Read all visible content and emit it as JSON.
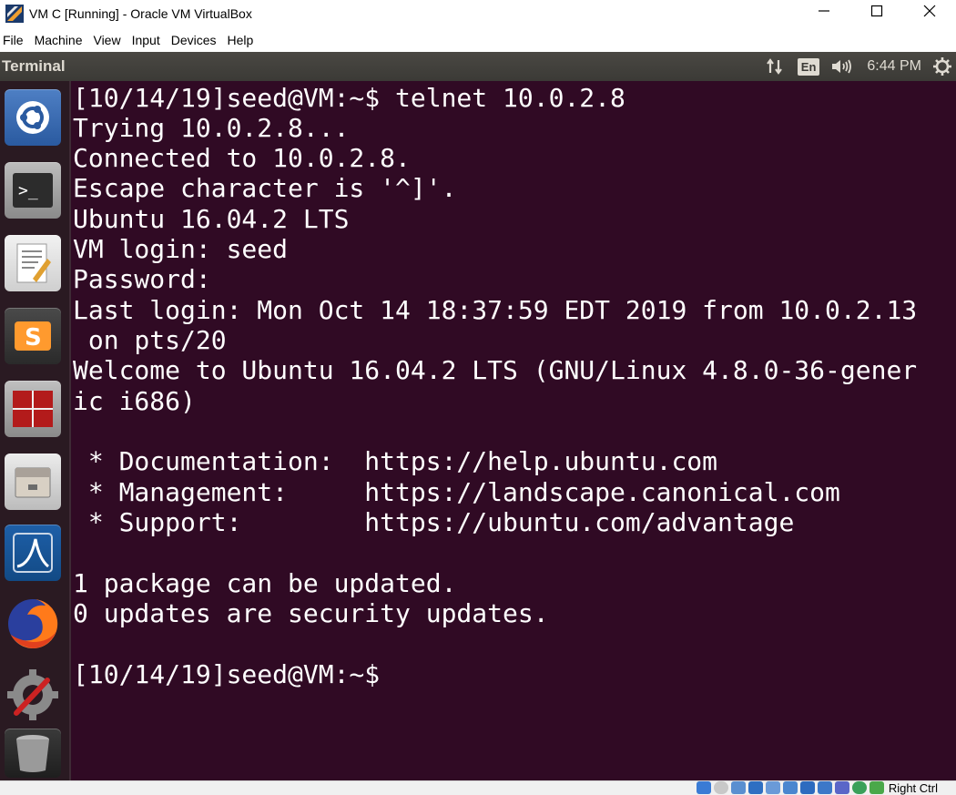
{
  "window": {
    "title": "VM C [Running] - Oracle VM VirtualBox",
    "controls": [
      "minimize-icon",
      "maximize-icon",
      "close-icon"
    ]
  },
  "menubar": {
    "items": [
      "File",
      "Machine",
      "View",
      "Input",
      "Devices",
      "Help"
    ]
  },
  "topbar": {
    "title": "Terminal",
    "keyboard_layout": "En",
    "clock": "6:44 PM",
    "indicators": [
      "network-icon",
      "keyboard-layout-indicator",
      "volume-icon",
      "clock",
      "system-gear-icon"
    ]
  },
  "launcher": {
    "items": [
      "ubuntu-dash-icon",
      "terminal-icon",
      "text-editor-icon",
      "sublime-text-icon",
      "terminator-icon",
      "files-icon",
      "wireshark-icon",
      "firefox-icon",
      "system-settings-icon",
      "trash-icon"
    ]
  },
  "terminal": {
    "lines": [
      "[10/14/19]seed@VM:~$ telnet 10.0.2.8",
      "Trying 10.0.2.8...",
      "Connected to 10.0.2.8.",
      "Escape character is '^]'.",
      "Ubuntu 16.04.2 LTS",
      "VM login: seed",
      "Password:",
      "Last login: Mon Oct 14 18:37:59 EDT 2019 from 10.0.2.13",
      " on pts/20",
      "Welcome to Ubuntu 16.04.2 LTS (GNU/Linux 4.8.0-36-gener",
      "ic i686)",
      "",
      " * Documentation:  https://help.ubuntu.com",
      " * Management:     https://landscape.canonical.com",
      " * Support:        https://ubuntu.com/advantage",
      "",
      "1 package can be updated.",
      "0 updates are security updates.",
      "",
      "[10/14/19]seed@VM:~$"
    ]
  },
  "statusbar": {
    "host_key": "Right Ctrl"
  },
  "colors": {
    "terminal_bg": "#300a24",
    "terminal_fg": "#ffffff",
    "topbar_bg": "#3b3a36",
    "launcher_bg": "#2a1a22"
  }
}
